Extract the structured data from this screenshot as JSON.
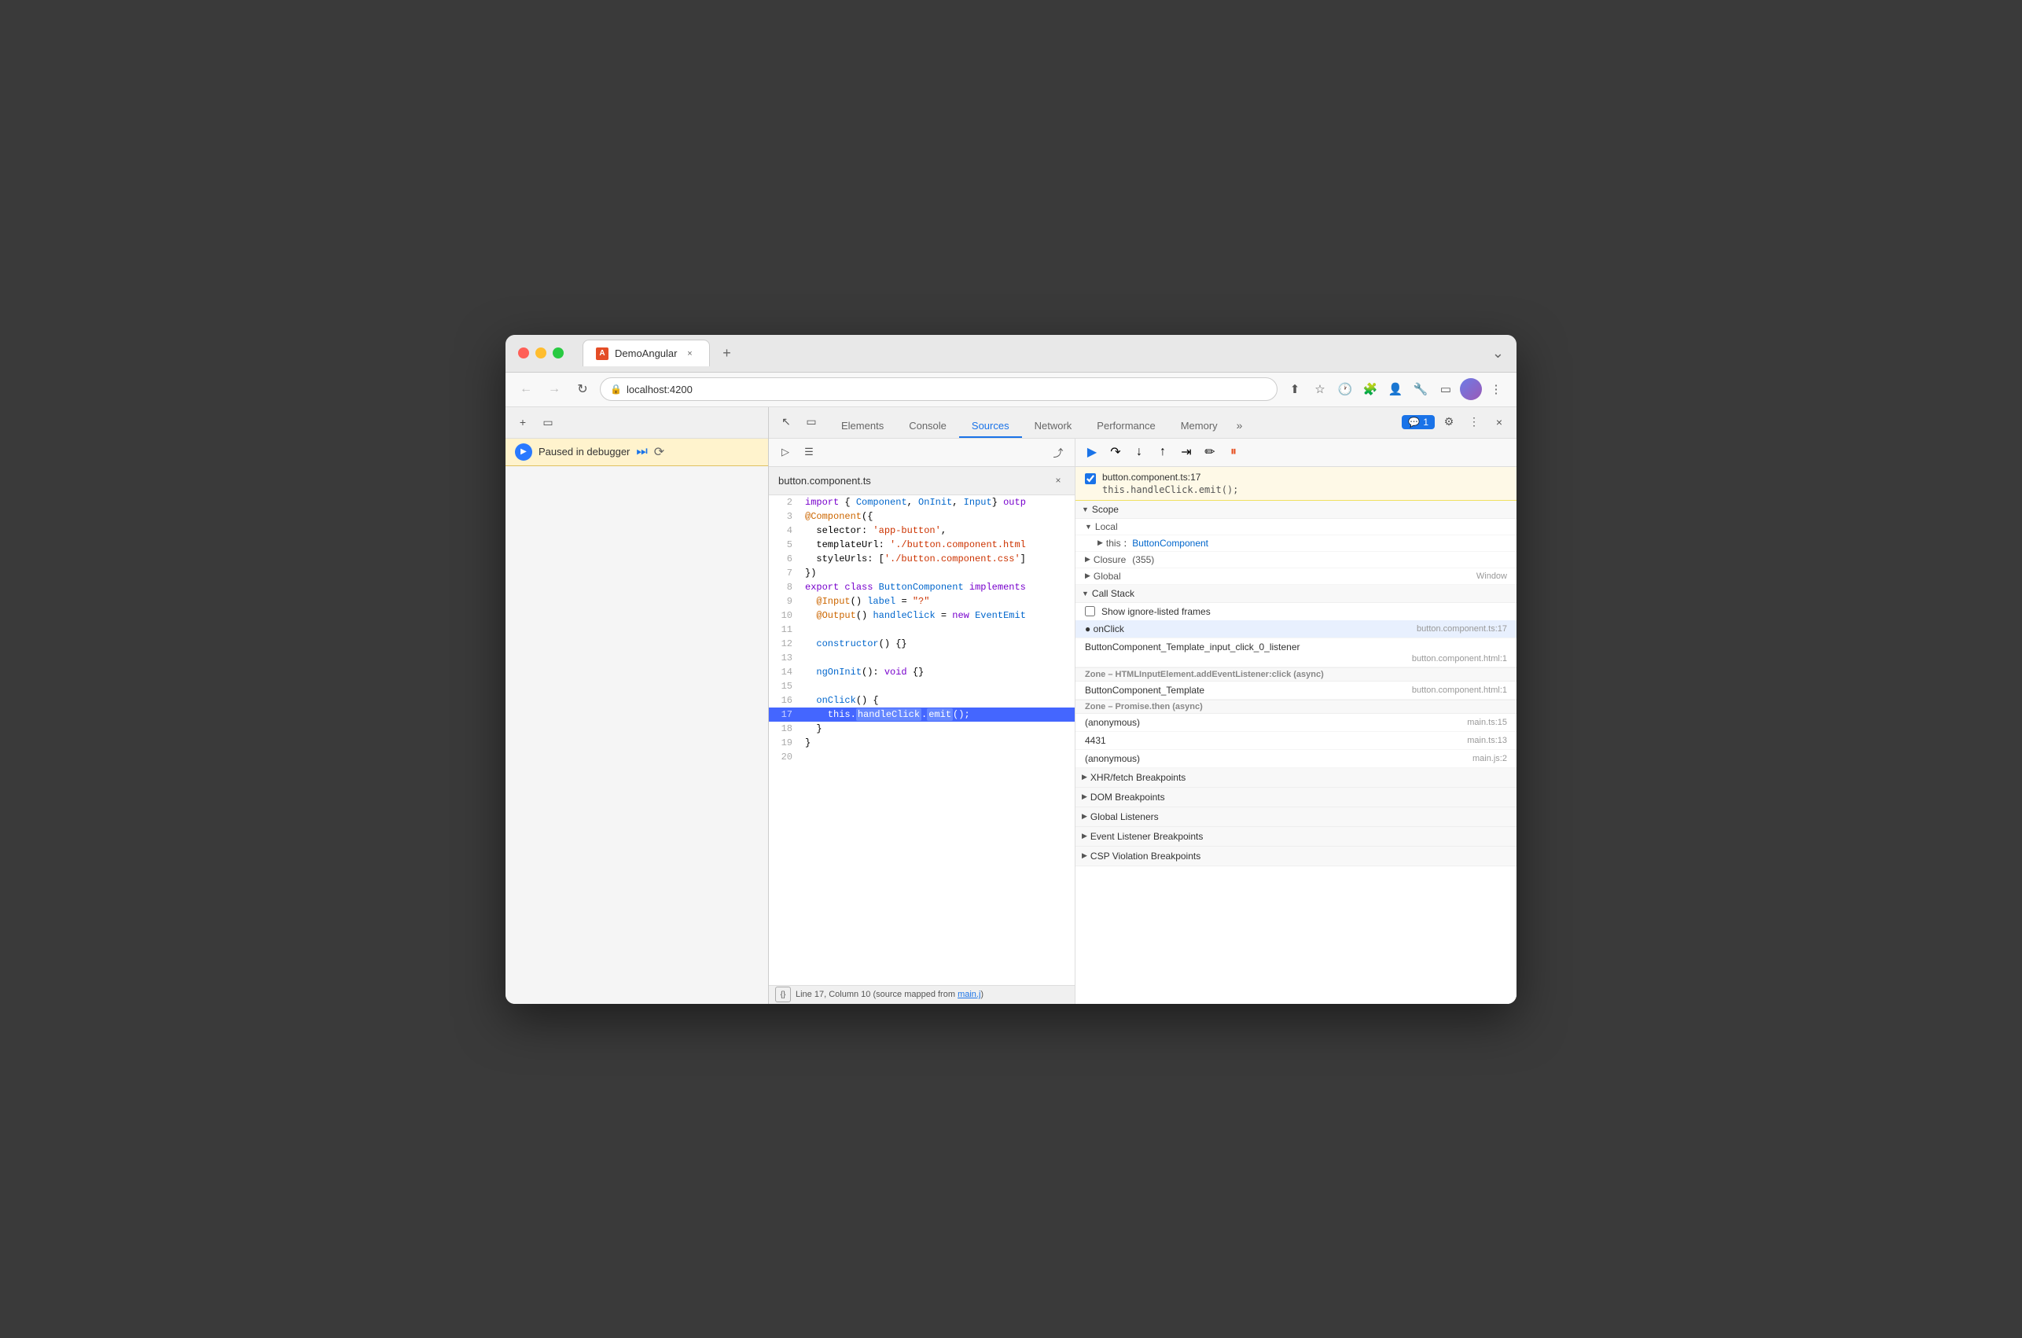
{
  "browser": {
    "tab_title": "DemoAngular",
    "tab_close": "×",
    "new_tab": "+",
    "url": "localhost:4200",
    "window_chevron": "⌄"
  },
  "nav": {
    "back": "←",
    "forward": "→",
    "reload": "↻",
    "lock_icon": "🔒",
    "bookmark": "☆",
    "extensions": "🧩",
    "profile": "",
    "more": "⋮"
  },
  "page_panel": {
    "inspect_icon": "⬛",
    "device_icon": "▭",
    "paused_text": "Paused in debugger",
    "play_icon": "▶",
    "skip_icon": "⏭"
  },
  "devtools": {
    "cursor_icon": "↖",
    "device_icon": "▭",
    "tabs": [
      "Elements",
      "Console",
      "Sources",
      "Network",
      "Performance",
      "Memory"
    ],
    "active_tab": "Sources",
    "more_tabs": "»",
    "notification_count": "1",
    "settings_icon": "⚙",
    "more_icon": "⋮",
    "close_icon": "×"
  },
  "sources": {
    "file_name": "button.component.ts",
    "panel_icon1": "▷",
    "panel_icon2": "☰",
    "navigate_icon": "⤴",
    "code_lines": [
      {
        "num": 2,
        "content": "import { Component, OnInit, Input} outp"
      },
      {
        "num": 3,
        "content": "@Component({"
      },
      {
        "num": 4,
        "content": "  selector: 'app-button',"
      },
      {
        "num": 5,
        "content": "  templateUrl: './button.component.html"
      },
      {
        "num": 6,
        "content": "  styleUrls: ['./button.component.css']"
      },
      {
        "num": 7,
        "content": "})"
      },
      {
        "num": 8,
        "content": "export class ButtonComponent implements"
      },
      {
        "num": 9,
        "content": "  @Input() label = \"?\""
      },
      {
        "num": 10,
        "content": "  @Output() handleClick = new EventEmit"
      },
      {
        "num": 11,
        "content": ""
      },
      {
        "num": 12,
        "content": "  constructor() {}"
      },
      {
        "num": 13,
        "content": ""
      },
      {
        "num": 14,
        "content": "  ngOnInit(): void {}"
      },
      {
        "num": 15,
        "content": ""
      },
      {
        "num": 16,
        "content": "  onClick() {"
      },
      {
        "num": 17,
        "content": "    this.handleClick.emit();",
        "highlighted": true
      },
      {
        "num": 18,
        "content": "  }"
      },
      {
        "num": 19,
        "content": "}"
      },
      {
        "num": 20,
        "content": ""
      }
    ],
    "status_text": "Line 17, Column 10 (source mapped from main.j",
    "format_icon": "{}",
    "source_link": "main.j"
  },
  "debugger": {
    "resume_icon": "▶",
    "step_over_icon": "↷",
    "step_into_icon": "↓",
    "step_out_icon": "↑",
    "step_icon": "⇥",
    "deactivate_icon": "✏",
    "pause_on_exceptions": "⏸",
    "breakpoint": {
      "location": "button.component.ts:17",
      "code": "this.handleClick.emit();"
    },
    "scope": {
      "title": "Scope",
      "local": {
        "title": "Local",
        "this_label": "this",
        "this_value": "ButtonComponent"
      },
      "closure": {
        "title": "Closure",
        "count": "(355)"
      },
      "global": {
        "title": "Global",
        "value": "Window"
      }
    },
    "call_stack": {
      "title": "Call Stack",
      "show_ignored": "Show ignore-listed frames",
      "frames": [
        {
          "name": "onClick",
          "location": "button.component.ts:17",
          "active": true
        },
        {
          "name": "ButtonComponent_Template_input_click_0_listener",
          "location": "button.component.html:1",
          "active": false
        }
      ],
      "zone1": "Zone – HTMLInputElement.addEventListener:click (async)",
      "frames2": [
        {
          "name": "ButtonComponent_Template",
          "location": "button.component.html:1",
          "active": false
        }
      ],
      "zone2": "Zone – Promise.then (async)",
      "frames3": [
        {
          "name": "(anonymous)",
          "location": "main.ts:15",
          "active": false
        },
        {
          "name": "4431",
          "location": "main.ts:13",
          "active": false
        },
        {
          "name": "(anonymous)",
          "location": "main.js:2",
          "active": false
        }
      ]
    },
    "sections": [
      "XHR/fetch Breakpoints",
      "DOM Breakpoints",
      "Global Listeners",
      "Event Listener Breakpoints",
      "CSP Violation Breakpoints"
    ]
  }
}
